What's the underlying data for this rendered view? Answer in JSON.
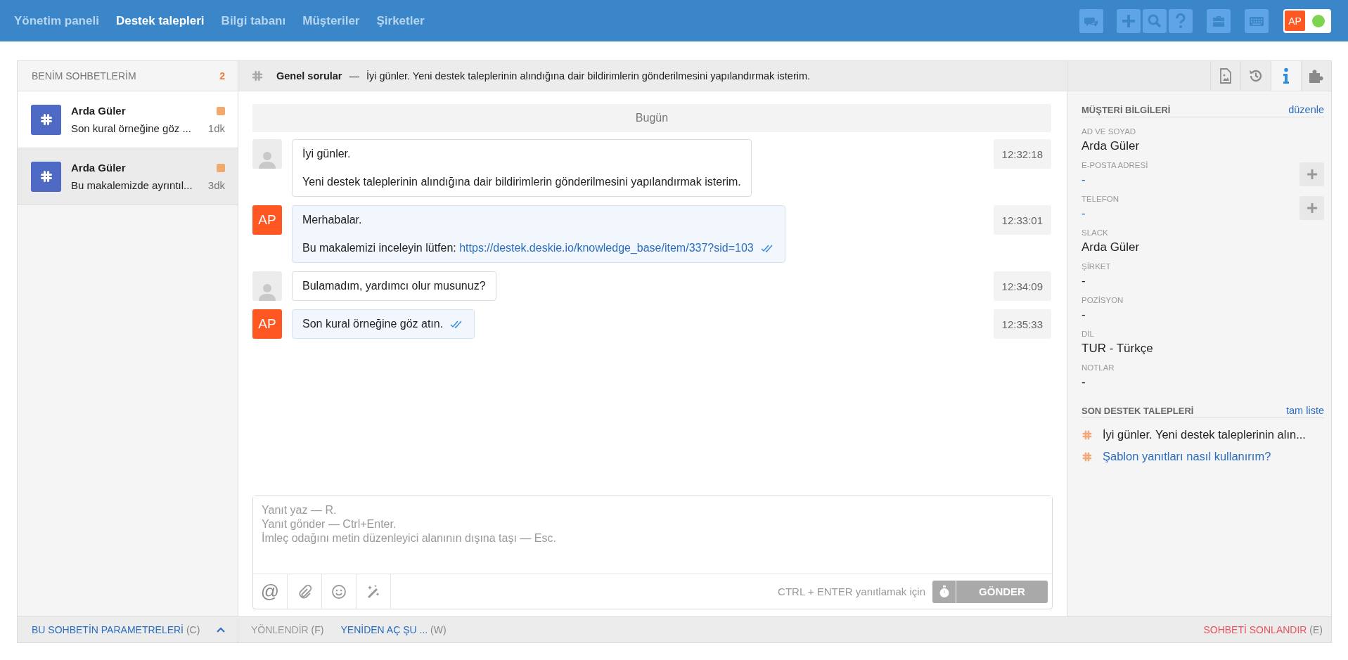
{
  "nav": [
    {
      "label": "Yönetim paneli",
      "selected": false
    },
    {
      "label": "Destek talepleri",
      "selected": true
    },
    {
      "label": "Bilgi tabanı",
      "selected": false
    },
    {
      "label": "Müşteriler",
      "selected": false
    },
    {
      "label": "Şirketler",
      "selected": false
    }
  ],
  "toolbar": [
    {
      "kind": "chat"
    },
    {
      "kind": "plus"
    },
    {
      "kind": "search"
    },
    {
      "kind": "help"
    },
    {
      "kind": "briefcase"
    },
    {
      "kind": "keyboard"
    }
  ],
  "user": {
    "initials": "AP",
    "online": true
  },
  "sidebar": {
    "title": "BENİM SOHBETLERİM",
    "count": "2",
    "items": [
      {
        "name": "Arda Güler",
        "preview": "Son kural örneğine göz ...",
        "time": "1dk",
        "selected": true,
        "color": "#f0a96e"
      },
      {
        "name": "Arda Güler",
        "preview": "Bu makalemizde ayrıntıl...",
        "time": "3dk",
        "selected": false,
        "color": "#f0a96e"
      }
    ]
  },
  "chat_header": {
    "channel": "Genel sorular",
    "separator": "—",
    "subject": "İyi günler. Yeni destek taleplerinin alındığına dair bildirimlerin gönderilmesini yapılandırmak isterim."
  },
  "date_divider": "Bugün",
  "messages": [
    {
      "kind": "customer",
      "paragraphs": [
        {
          "text": "İyi günler."
        },
        {
          "text": "Yeni destek taleplerinin alındığına dair bildirimlerin gönderilmesini yapılandırmak isterim."
        }
      ],
      "time": "12:32:18",
      "read": false
    },
    {
      "kind": "agent",
      "initials": "AP",
      "paragraphs": [
        {
          "text": "Merhabalar."
        },
        {
          "text": "Bu makalemizi inceleyin lütfen: ",
          "link": "https://destek.deskie.io/knowledge_base/item/337?sid=103"
        }
      ],
      "time": "12:33:01",
      "read": true
    },
    {
      "kind": "customer",
      "paragraphs": [
        {
          "text": "Bulamadım, yardımcı olur musunuz?"
        }
      ],
      "time": "12:34:09",
      "read": false
    },
    {
      "kind": "agent",
      "initials": "AP",
      "paragraphs": [
        {
          "text": "Son kural örneğine göz atın."
        }
      ],
      "time": "12:35:33",
      "read": true
    }
  ],
  "composer": {
    "placeholder": "Yanıt yaz — R.\nYanıt gönder — Ctrl+Enter.\nİmleç odağını metin düzenleyici alanının dışına taşı — Esc.",
    "tools": [
      {
        "kind": "mention",
        "label": "@"
      },
      {
        "kind": "attach"
      },
      {
        "kind": "emoji"
      },
      {
        "kind": "magic"
      }
    ],
    "hint": "CTRL + ENTER yanıtlamak için",
    "send": "GÖNDER",
    "send_disabled": true
  },
  "panel_tabs": [
    {
      "kind": "document",
      "selected": false
    },
    {
      "kind": "history",
      "selected": false
    },
    {
      "kind": "info",
      "selected": true
    },
    {
      "kind": "plugin",
      "selected": false
    }
  ],
  "customer_info": {
    "title": "MÜŞTERİ BİLGİLERİ",
    "action": "düzenle",
    "fields": [
      {
        "label": "AD VE SOYAD",
        "value": "Arda Güler",
        "addable": false,
        "empty": false
      },
      {
        "label": "E-POSTA ADRESİ",
        "value": "-",
        "addable": true,
        "empty": true
      },
      {
        "label": "TELEFON",
        "value": "-",
        "addable": true,
        "empty": true
      },
      {
        "label": "SLACK",
        "value": "Arda Güler",
        "addable": false,
        "empty": false
      },
      {
        "label": "ŞİRKET",
        "value": "-",
        "addable": false,
        "empty": false
      },
      {
        "label": "POZİSYON",
        "value": "-",
        "addable": false,
        "empty": false
      },
      {
        "label": "DİL",
        "value": "TUR - Türkçe",
        "addable": false,
        "empty": false
      },
      {
        "label": "NOTLAR",
        "value": "-",
        "addable": false,
        "empty": false
      }
    ]
  },
  "recent": {
    "title": "SON DESTEK TALEPLERİ",
    "action": "tam liste",
    "items": [
      {
        "text": "İyi günler. Yeni destek taleplerinin alın...",
        "current": true
      },
      {
        "text": "Şablon yanıtları nasıl kullanırım?",
        "current": false
      }
    ]
  },
  "footer": {
    "params": {
      "label": "BU SOHBETİN PARAMETRELERİ",
      "key": "(C)"
    },
    "actions": [
      {
        "label": "YÖNLENDİR",
        "key": "(F)",
        "disabled": true
      },
      {
        "label": "YENİDEN AÇ ŞU ...",
        "key": "(W)",
        "disabled": false
      }
    ],
    "end": {
      "label": "SOHBETİ SONLANDIR",
      "key": "(E)"
    }
  }
}
